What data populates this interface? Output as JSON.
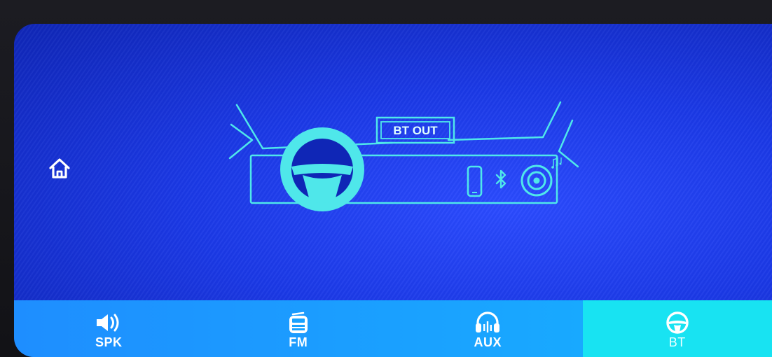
{
  "scene": {
    "badge_label": "BT OUT"
  },
  "home": {
    "icon": "home-icon"
  },
  "tabs": [
    {
      "id": "spk",
      "label": "SPK",
      "icon": "speaker-icon",
      "active": false
    },
    {
      "id": "fm",
      "label": "FM",
      "icon": "radio-icon",
      "active": false
    },
    {
      "id": "aux",
      "label": "AUX",
      "icon": "headphones-icon",
      "active": false
    },
    {
      "id": "bt",
      "label": "BT",
      "icon": "steering-wheel-icon",
      "active": true
    }
  ],
  "colors": {
    "screen_blue": "#1b39e6",
    "line_cyan": "#4fe7ea",
    "tab_active": "#18e3f2",
    "tab_bar": "#1aa2ff"
  }
}
